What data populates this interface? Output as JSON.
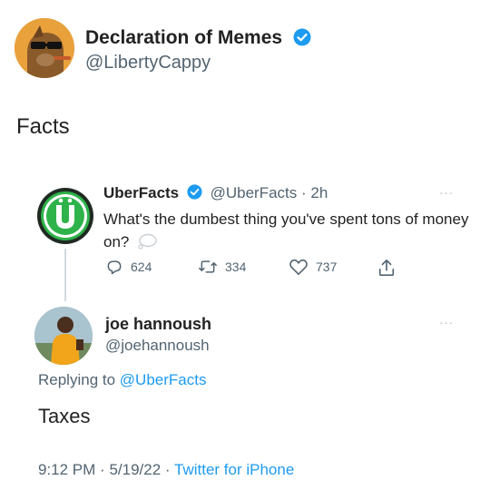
{
  "main_tweet": {
    "display_name": "Declaration of Memes",
    "handle": "@LibertyCappy",
    "text": "Facts"
  },
  "quoted_tweet": {
    "display_name": "UberFacts",
    "handle": "@UberFacts",
    "separator": "·",
    "time": "2h",
    "text": "What's the dumbest thing you've spent tons of money on?",
    "replies": "624",
    "retweets": "334",
    "likes": "737",
    "more": "···"
  },
  "reply_tweet": {
    "display_name": "joe hannoush",
    "handle": "@joehannoush",
    "replying_prefix": "Replying to",
    "replying_to": "@UberFacts",
    "text": "Taxes",
    "time": "9:12 PM",
    "date": "5/19/22",
    "source": "Twitter for iPhone",
    "more": "···"
  },
  "colors": {
    "link": "#1d9bf0",
    "verified": "#1d9bf0",
    "secondary_text": "#536471",
    "uberfacts_green": "#2eb34a"
  }
}
